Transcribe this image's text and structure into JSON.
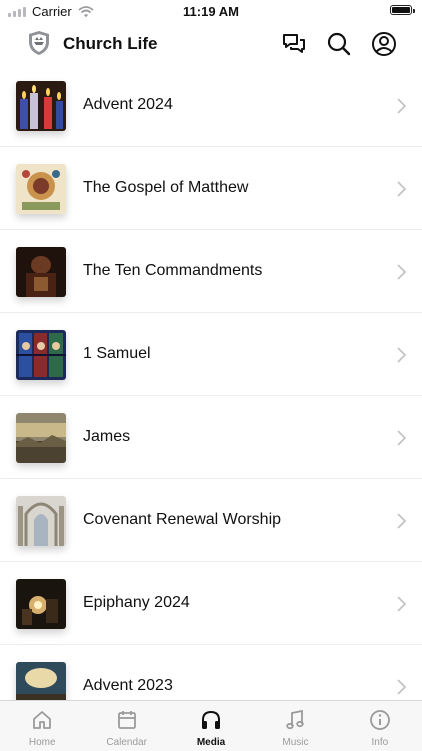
{
  "status": {
    "carrier": "Carrier",
    "time": "11:19 AM"
  },
  "header": {
    "title": "Church Life"
  },
  "icons": {
    "logo": "shield-logo",
    "messages": "chat-bubbles-icon",
    "search": "search-icon",
    "profile": "user-circle-icon"
  },
  "items": [
    {
      "label": "Advent 2024",
      "thumb": "candles"
    },
    {
      "label": "The Gospel of Matthew",
      "thumb": "illuminated-manuscript"
    },
    {
      "label": "The Ten Commandments",
      "thumb": "dark-painting"
    },
    {
      "label": "1 Samuel",
      "thumb": "stained-glass"
    },
    {
      "label": "James",
      "thumb": "landscape-storm"
    },
    {
      "label": "Covenant Renewal Worship",
      "thumb": "cathedral-interior"
    },
    {
      "label": "Epiphany 2024",
      "thumb": "nativity-painting"
    },
    {
      "label": "Advent 2023",
      "thumb": "sky-painting"
    }
  ],
  "tabs": [
    {
      "label": "Home",
      "icon": "home-icon",
      "active": false
    },
    {
      "label": "Calendar",
      "icon": "calendar-icon",
      "active": false
    },
    {
      "label": "Media",
      "icon": "headphones-icon",
      "active": true
    },
    {
      "label": "Music",
      "icon": "music-note-icon",
      "active": false
    },
    {
      "label": "Info",
      "icon": "info-icon",
      "active": false
    }
  ],
  "colors": {
    "accent": "#111111",
    "inactive": "#9a9a9a",
    "divider": "#ececec"
  }
}
